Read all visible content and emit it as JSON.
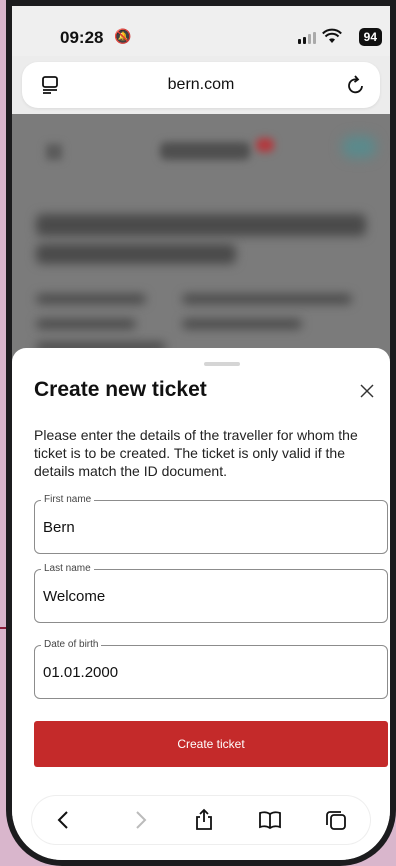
{
  "status_bar": {
    "time": "09:28",
    "battery": "94"
  },
  "browser": {
    "url": "bern.com"
  },
  "sheet": {
    "title": "Create new ticket",
    "intro": "Please enter the details of the traveller for whom the ticket is to be created. The ticket is only valid if the details match the ID document.",
    "fields": [
      {
        "label": "First name",
        "value": "Bern"
      },
      {
        "label": "Last name",
        "value": "Welcome"
      },
      {
        "label": "Date of birth",
        "value": "01.01.2000"
      }
    ],
    "submit_label": "Create ticket"
  },
  "toolbar": {
    "icons": [
      "back-icon",
      "forward-icon",
      "share-icon",
      "bookmarks-icon",
      "tabs-icon"
    ]
  },
  "colors": {
    "accent": "#c42a2a",
    "background": "#d9b6cc"
  }
}
